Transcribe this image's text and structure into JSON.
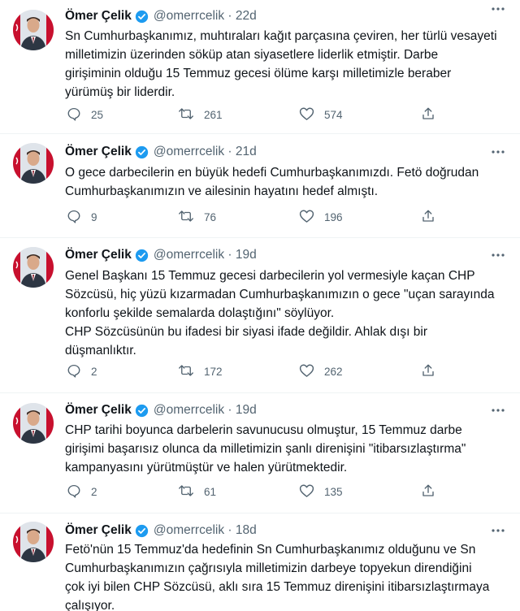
{
  "author": {
    "name": "Ömer Çelik",
    "handle": "@omerrcelik"
  },
  "tweets": [
    {
      "time": "22d",
      "text": "Sn Cumhurbaşkanımız, muhtıraları kağıt parçasına çeviren, her türlü vesayeti\nmilletimizin üzerinden söküp atan siyasetlere liderlik etmiştir. Darbe\ngirişiminin olduğu 15 Temmuz gecesi ölüme karşı milletimizle beraber\nyürümüş bir liderdir.",
      "replies": "25",
      "retweets": "261",
      "likes": "574"
    },
    {
      "time": "21d",
      "text": "O gece darbecilerin en büyük hedefi Cumhurbaşkanımızdı. Fetö doğrudan\nCumhurbaşkanımızın ve ailesinin hayatını hedef almıştı.",
      "replies": "9",
      "retweets": "76",
      "likes": "196"
    },
    {
      "time": "19d",
      "text": "Genel Başkanı 15 Temmuz gecesi darbecilerin yol vermesiyle kaçan CHP\nSözcüsü, hiç yüzü kızarmadan Cumhurbaşkanımızın o gece \"uçan sarayında\nkonforlu şekilde semalarda dolaştığını\" söylüyor.\nCHP Sözcüsünün bu ifadesi bir siyasi ifade değildir. Ahlak dışı bir\ndüşmanlıktır.",
      "replies": "2",
      "retweets": "172",
      "likes": "262"
    },
    {
      "time": "19d",
      "text": "CHP tarihi boyunca darbelerin savunucusu olmuştur, 15 Temmuz darbe\ngirişimi başarısız olunca da milletimizin şanlı direnişini \"itibarsızlaştırma\"\nkampanyasını yürütmüştür ve halen yürütmektedir.",
      "replies": "2",
      "retweets": "61",
      "likes": "135"
    },
    {
      "time": "18d",
      "text": "Fetö'nün 15 Temmuz'da hedefinin Sn Cumhurbaşkanımız olduğunu ve Sn\nCumhurbaşkanımızın çağrısıyla milletimizin darbeye topyekun direndiğini\nçok iyi bilen CHP Sözcüsü, aklı sıra 15 Temmuz direnişini itibarsızlaştırmaya\nçalışıyor."
    }
  ],
  "colors": {
    "text": "#0f1419",
    "secondary": "#536471",
    "verified": "#1d9bf0",
    "divider": "#eff3f4"
  },
  "icons": [
    "verified-badge-icon",
    "more-icon",
    "reply-icon",
    "retweet-icon",
    "like-icon",
    "share-icon"
  ]
}
